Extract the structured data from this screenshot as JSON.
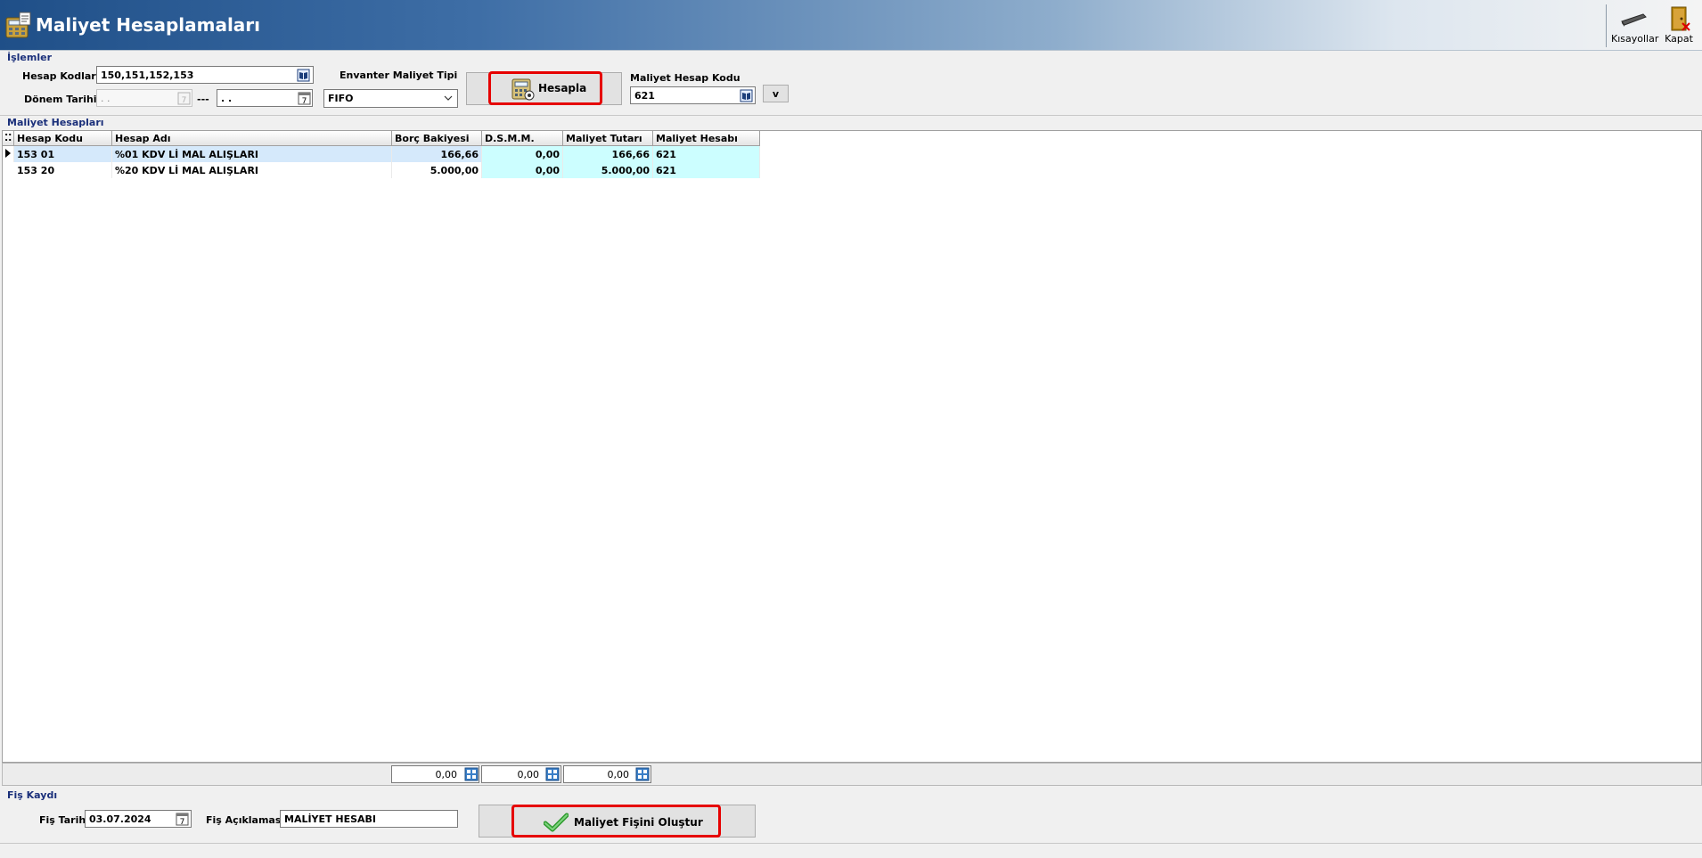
{
  "window": {
    "title": "Maliyet Hesaplamaları"
  },
  "toolbar": {
    "shortcuts_label": "Kısayollar",
    "close_label": "Kapat"
  },
  "islemler": {
    "section_label": "İşlemler",
    "hesap_kodlari_label": "Hesap Kodları",
    "hesap_kodlari_value": "150,151,152,153",
    "donem_tarihi_label": "Dönem Tarihi",
    "donem_start_value": " .  .",
    "donem_separator": "---",
    "donem_end_value": " .  .",
    "envanter_label": "Envanter Maliyet Tipi",
    "envanter_value": "FIFO",
    "hesapla_label": "Hesapla",
    "maliyet_hesap_kodu_label": "Maliyet Hesap Kodu",
    "maliyet_hesap_kodu_value": "621",
    "v_button_label": "v"
  },
  "grid": {
    "section_label": "Maliyet Hesapları",
    "columns": [
      "Hesap Kodu",
      "Hesap Adı",
      "Borç Bakiyesi",
      "D.S.M.M.",
      "Maliyet Tutarı",
      "Maliyet Hesabı"
    ],
    "rows": [
      [
        "153 01",
        "%01 KDV Lİ MAL ALIŞLARI",
        "166,66",
        "0,00",
        "166,66",
        "621"
      ],
      [
        "153 20",
        "%20 KDV Lİ MAL ALIŞLARI",
        "5.000,00",
        "0,00",
        "5.000,00",
        "621"
      ]
    ],
    "totals": [
      "0,00",
      "0,00",
      "0,00"
    ]
  },
  "fis": {
    "section_label": "Fiş Kaydı",
    "tarih_label": "Fiş Tarihi",
    "tarih_value": "03.07.2024",
    "aciklama_label": "Fiş Açıklaması",
    "aciklama_value": "MALİYET HESABI",
    "olustur_label": "Maliyet Fişini Oluştur"
  },
  "colors": {
    "highlight": "#e60000",
    "cyan_cell": "#ccfeff",
    "title_blue": "#1f4f88"
  }
}
